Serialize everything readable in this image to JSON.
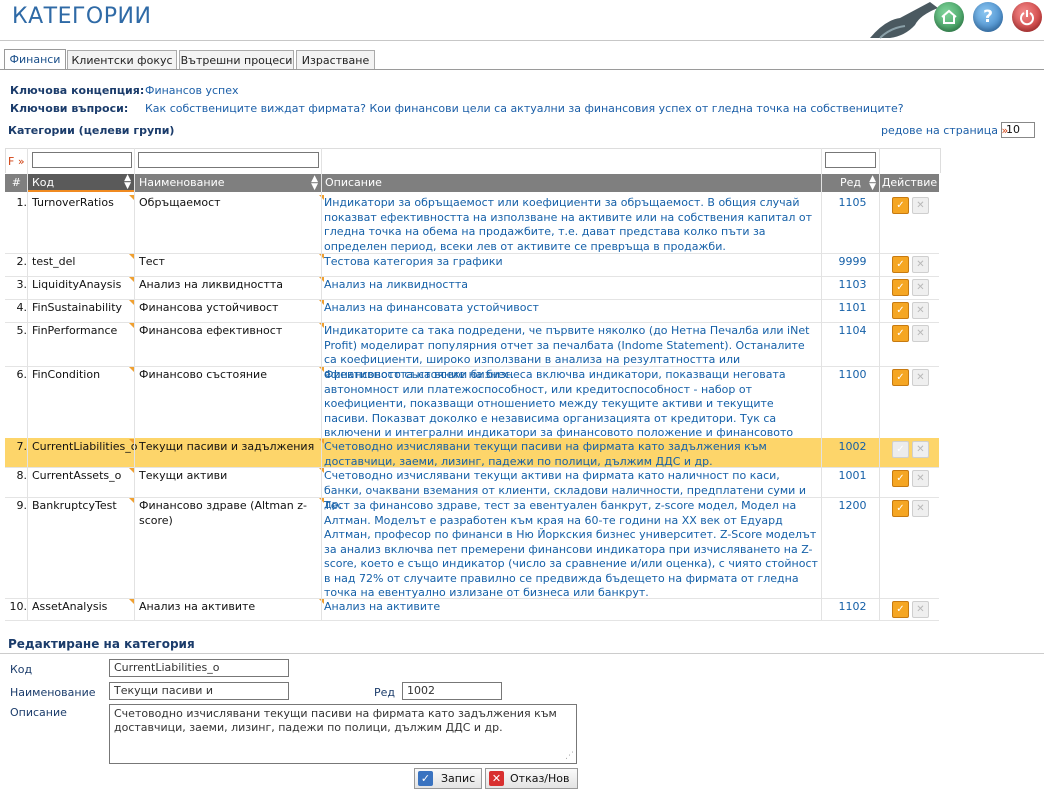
{
  "header": {
    "title": "КАТЕГОРИИ",
    "buttons": [
      {
        "icon": "home-icon",
        "color": "#3c9a5a"
      },
      {
        "icon": "help-icon",
        "color": "#3a86c8"
      },
      {
        "icon": "power-icon",
        "color": "#d23b3b"
      }
    ]
  },
  "tabs": [
    "Финанси",
    "Клиентски фокус",
    "Вътрешни процеси",
    "Израстване"
  ],
  "info": {
    "concept_label": "Ключова концепция:",
    "concept_value": "Финансов успех",
    "questions_label": "Ключови въпроси:",
    "questions_value": "Как собствениците виждат фирмата? Кои финансови цели са актуални за финансовия успех от гледна точка на собствениците?"
  },
  "grid": {
    "title": "Категории (целеви групи)",
    "rows_per_page_label": "редове на страница",
    "rows_per_page_arrow": "»",
    "rows_per_page": "10",
    "filter_marker": "F »",
    "columns": {
      "num": "#",
      "code": "Код",
      "name": "Наименование",
      "desc": "Описание",
      "order": "Ред",
      "action": "Действие"
    },
    "rows": [
      {
        "num": "1.",
        "code": "TurnoverRatios",
        "name": "Обръщаемост",
        "desc": "Индикатори за обръщаемост или коефициенти за обръщаемост. В общия случай показват ефективността на използване на активите или на собствения капитал от гледна точка на обема на продажбите, т.е. дават представа колко пъти за определен период, всеки лев от активите се превръща в продажби.",
        "order": "1105"
      },
      {
        "num": "2.",
        "code": "test_del",
        "name": "Тест",
        "desc": "Тестова категория за графики",
        "order": "9999"
      },
      {
        "num": "3.",
        "code": "LiquidityAnaysis",
        "name": "Анализ на ликвидността",
        "desc": "Анализ на ликвидността",
        "order": "1103"
      },
      {
        "num": "4.",
        "code": "FinSustainability",
        "name": "Финансова устойчивост",
        "desc": "Анализ на финансовата устойчивост",
        "order": "1101"
      },
      {
        "num": "5.",
        "code": "FinPerformance",
        "name": "Финансова ефективност",
        "desc": "Индикаторите са така подредени, че първите няколко (до Нетна Печалба или iNet Profit) моделират популярния отчет за печалбата (Indome Statement). Останалите са коефициенти, широко използвани в анализа на резултатността или ефективността на всеки бизнес.",
        "order": "1104"
      },
      {
        "num": "6.",
        "code": "FinCondition",
        "name": "Финансово състояние",
        "desc": "Финансовото състояние на бизнеса включва индикатори, показващи неговата автономност или платежоспособност, или кредитоспособност - набор от коефициенти, показващи отношението между текущите активи и текущите пасиви. Показват доколко е независима организацията от кредитори. Тук са включени и интегрални индикатори за финансовото положение и финансовото представяне или ефективност на бизнеса.",
        "order": "1100"
      },
      {
        "num": "7.",
        "code": "CurrentLiabilities_o",
        "name": "Текущи пасиви и задължения",
        "desc": "Счетоводно изчислявани текущи пасиви на фирмата като задължения към доставчици, заеми, лизинг, падежи по полици, дължим ДДС и др.",
        "order": "1002"
      },
      {
        "num": "8.",
        "code": "CurrentAssets_o",
        "name": "Текущи активи",
        "desc": "Счетоводно изчислявани текущи активи на фирмата като наличност по каси, банки, очаквани вземания от клиенти, складови наличности, предплатени суми и др.",
        "order": "1001"
      },
      {
        "num": "9.",
        "code": "BankruptcyTest",
        "name": "Финансово здраве (Altman z-score)",
        "desc": "Тест за финансово здраве, тест за евентуален банкрут, z-score модел, Модел на Алтман. Моделът е разработен към края на 60-те години на XX век от Едуард Алтман, професор по финанси в Ню Йоркския бизнес университет. Z-Score моделът за анализ включва пет премерени финансови индикатора при изчисляването на Z-score, което е също индикатор (число за сравнение и/или оценка), с чиято стойност в над 72% от случаите правилно се предвижда бъдещето на фирмата от гледна точка на евентуално излизане от бизнеса или банкрут.",
        "order": "1200"
      },
      {
        "num": "10.",
        "code": "AssetAnalysis",
        "name": "Анализ на активите",
        "desc": "Анализ на активите",
        "order": "1102"
      }
    ],
    "selected_row": 6
  },
  "edit": {
    "title": "Редактиране на категория",
    "code_label": "Код",
    "code_value": "CurrentLiabilities_o",
    "name_label": "Наименование",
    "name_value": "Текущи пасиви и задължения",
    "order_label": "Ред",
    "order_value": "1002",
    "desc_label": "Описание",
    "desc_value": "Счетоводно изчислявани текущи пасиви на фирмата като задължения към доставчици, заеми, лизинг, падежи по полици, дължим ДДС и др.",
    "save_label": "Запис",
    "cancel_label": "Отказ/Нов"
  },
  "colors": {
    "selected_row": "#fdd56a",
    "link": "#1560a8",
    "header_bg": "#7f7f7f",
    "accent": "#f5a623"
  }
}
